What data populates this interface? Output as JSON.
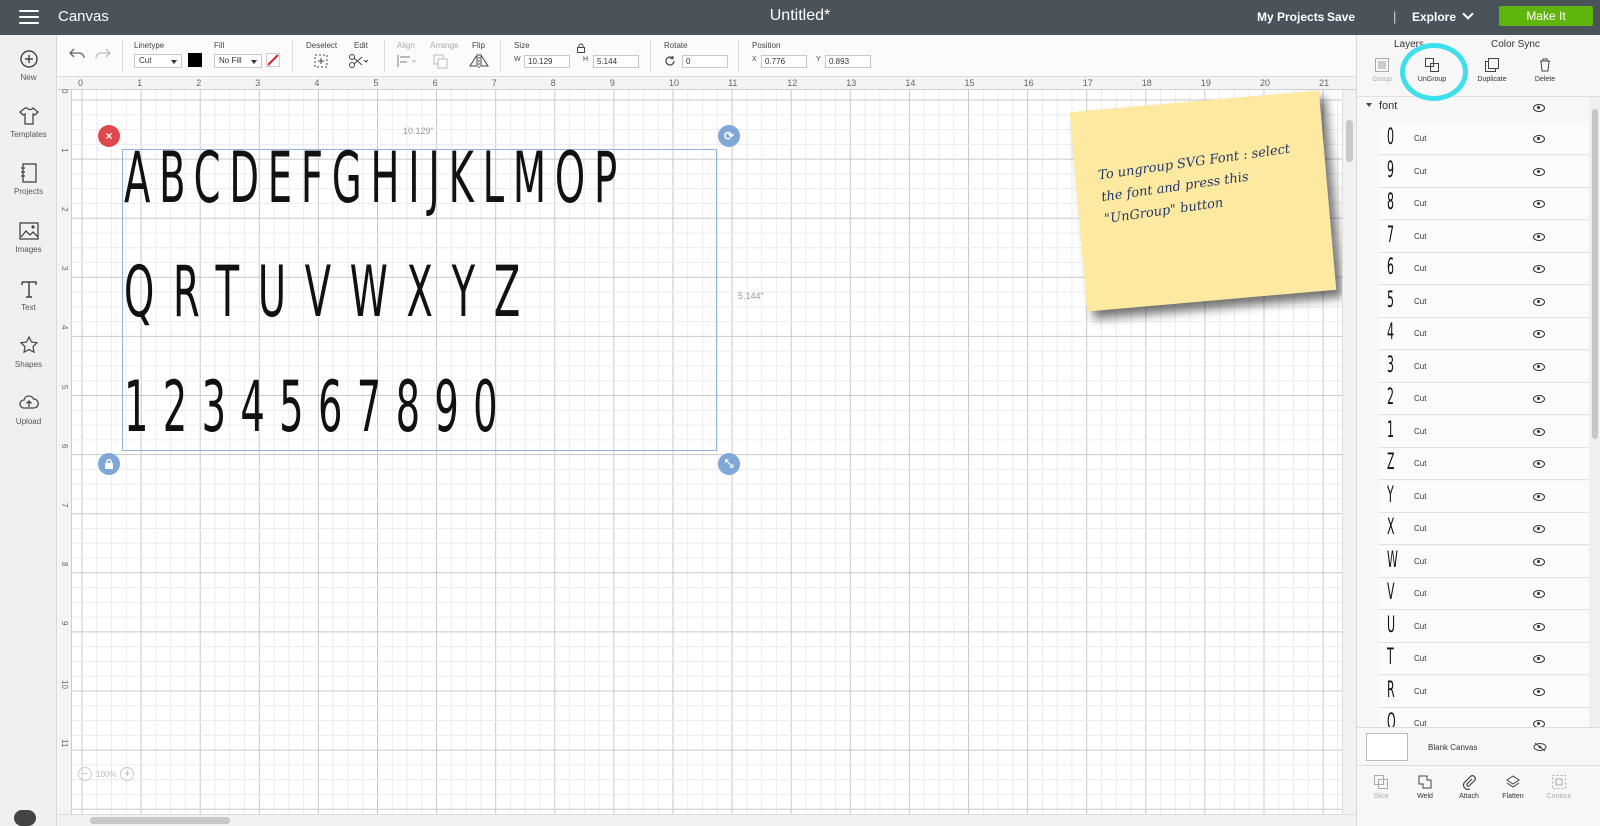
{
  "topbar": {
    "app_title": "Canvas",
    "doc_title": "Untitled*",
    "my_projects": "My Projects",
    "save": "Save",
    "separator": "|",
    "explore": "Explore",
    "make_it": "Make It"
  },
  "leftbar": {
    "items": [
      {
        "label": "New",
        "icon": "plus-circle-icon"
      },
      {
        "label": "Templates",
        "icon": "shirt-icon"
      },
      {
        "label": "Projects",
        "icon": "notebook-icon"
      },
      {
        "label": "Images",
        "icon": "image-icon"
      },
      {
        "label": "Text",
        "icon": "text-icon"
      },
      {
        "label": "Shapes",
        "icon": "shapes-icon"
      },
      {
        "label": "Upload",
        "icon": "cloud-upload-icon"
      }
    ]
  },
  "toolbar": {
    "linetype_label": "Linetype",
    "linetype_value": "Cut",
    "fill_label": "Fill",
    "fill_value": "No Fill",
    "deselect_label": "Deselect",
    "edit_label": "Edit",
    "align_label": "Align",
    "arrange_label": "Arrange",
    "flip_label": "Flip",
    "size_label": "Size",
    "size_w_letter": "W",
    "size_w": "10.129",
    "size_h_letter": "H",
    "size_h": "5.144",
    "rotate_label": "Rotate",
    "rotate_value": "0",
    "position_label": "Position",
    "pos_x_letter": "X",
    "pos_x": "0.776",
    "pos_y_letter": "Y",
    "pos_y": "0.893",
    "colors": {
      "fill_swatch": "#000000",
      "accent_red": "#d9242b"
    }
  },
  "canvas": {
    "ruler_h": [
      "0",
      "1",
      "2",
      "3",
      "4",
      "5",
      "6",
      "7",
      "8",
      "9",
      "10",
      "11",
      "12",
      "13",
      "14",
      "15",
      "16",
      "17",
      "18",
      "19",
      "20",
      "21"
    ],
    "ruler_v": [
      "0",
      "1",
      "2",
      "3",
      "4",
      "5",
      "6",
      "7",
      "8",
      "9",
      "10",
      "11"
    ],
    "width_dim": "10.129\"",
    "height_dim": "5.144\"",
    "glyph_rows": [
      "ABCDEFGHIJKLMOP",
      "QRTUVWXYZ",
      "1234567890"
    ],
    "zoom_minus": "−",
    "zoom_value": "100%",
    "zoom_plus": "+",
    "note_text": "To ungroup SVG Font : select the font and press this \"UnGroup\" button",
    "note_color": "#fde9a0"
  },
  "right_panel": {
    "tabs": [
      "Layers",
      "Color Sync"
    ],
    "actions": [
      {
        "label": "Group",
        "enabled": false,
        "icon": "group-icon"
      },
      {
        "label": "UnGroup",
        "enabled": true,
        "icon": "ungroup-icon"
      },
      {
        "label": "Duplicate",
        "enabled": true,
        "icon": "duplicate-icon"
      },
      {
        "label": "Delete",
        "enabled": true,
        "icon": "trash-icon"
      }
    ],
    "group_name": "font",
    "layers": [
      {
        "glyph": "0",
        "type": "Cut"
      },
      {
        "glyph": "9",
        "type": "Cut"
      },
      {
        "glyph": "8",
        "type": "Cut"
      },
      {
        "glyph": "7",
        "type": "Cut"
      },
      {
        "glyph": "6",
        "type": "Cut"
      },
      {
        "glyph": "5",
        "type": "Cut"
      },
      {
        "glyph": "4",
        "type": "Cut"
      },
      {
        "glyph": "3",
        "type": "Cut"
      },
      {
        "glyph": "2",
        "type": "Cut"
      },
      {
        "glyph": "1",
        "type": "Cut"
      },
      {
        "glyph": "Z",
        "type": "Cut"
      },
      {
        "glyph": "Y",
        "type": "Cut"
      },
      {
        "glyph": "X",
        "type": "Cut"
      },
      {
        "glyph": "W",
        "type": "Cut"
      },
      {
        "glyph": "V",
        "type": "Cut"
      },
      {
        "glyph": "U",
        "type": "Cut"
      },
      {
        "glyph": "T",
        "type": "Cut"
      },
      {
        "glyph": "R",
        "type": "Cut"
      },
      {
        "glyph": "Q",
        "type": "Cut"
      }
    ],
    "blank_canvas": "Blank Canvas",
    "bottom_actions": [
      {
        "label": "Slice",
        "enabled": false,
        "icon": "slice-icon"
      },
      {
        "label": "Weld",
        "enabled": true,
        "icon": "weld-icon"
      },
      {
        "label": "Attach",
        "enabled": true,
        "icon": "attach-icon"
      },
      {
        "label": "Flatten",
        "enabled": true,
        "icon": "flatten-icon"
      },
      {
        "label": "Contour",
        "enabled": false,
        "icon": "contour-icon"
      }
    ],
    "highlight_color": "#3fe0ec"
  }
}
